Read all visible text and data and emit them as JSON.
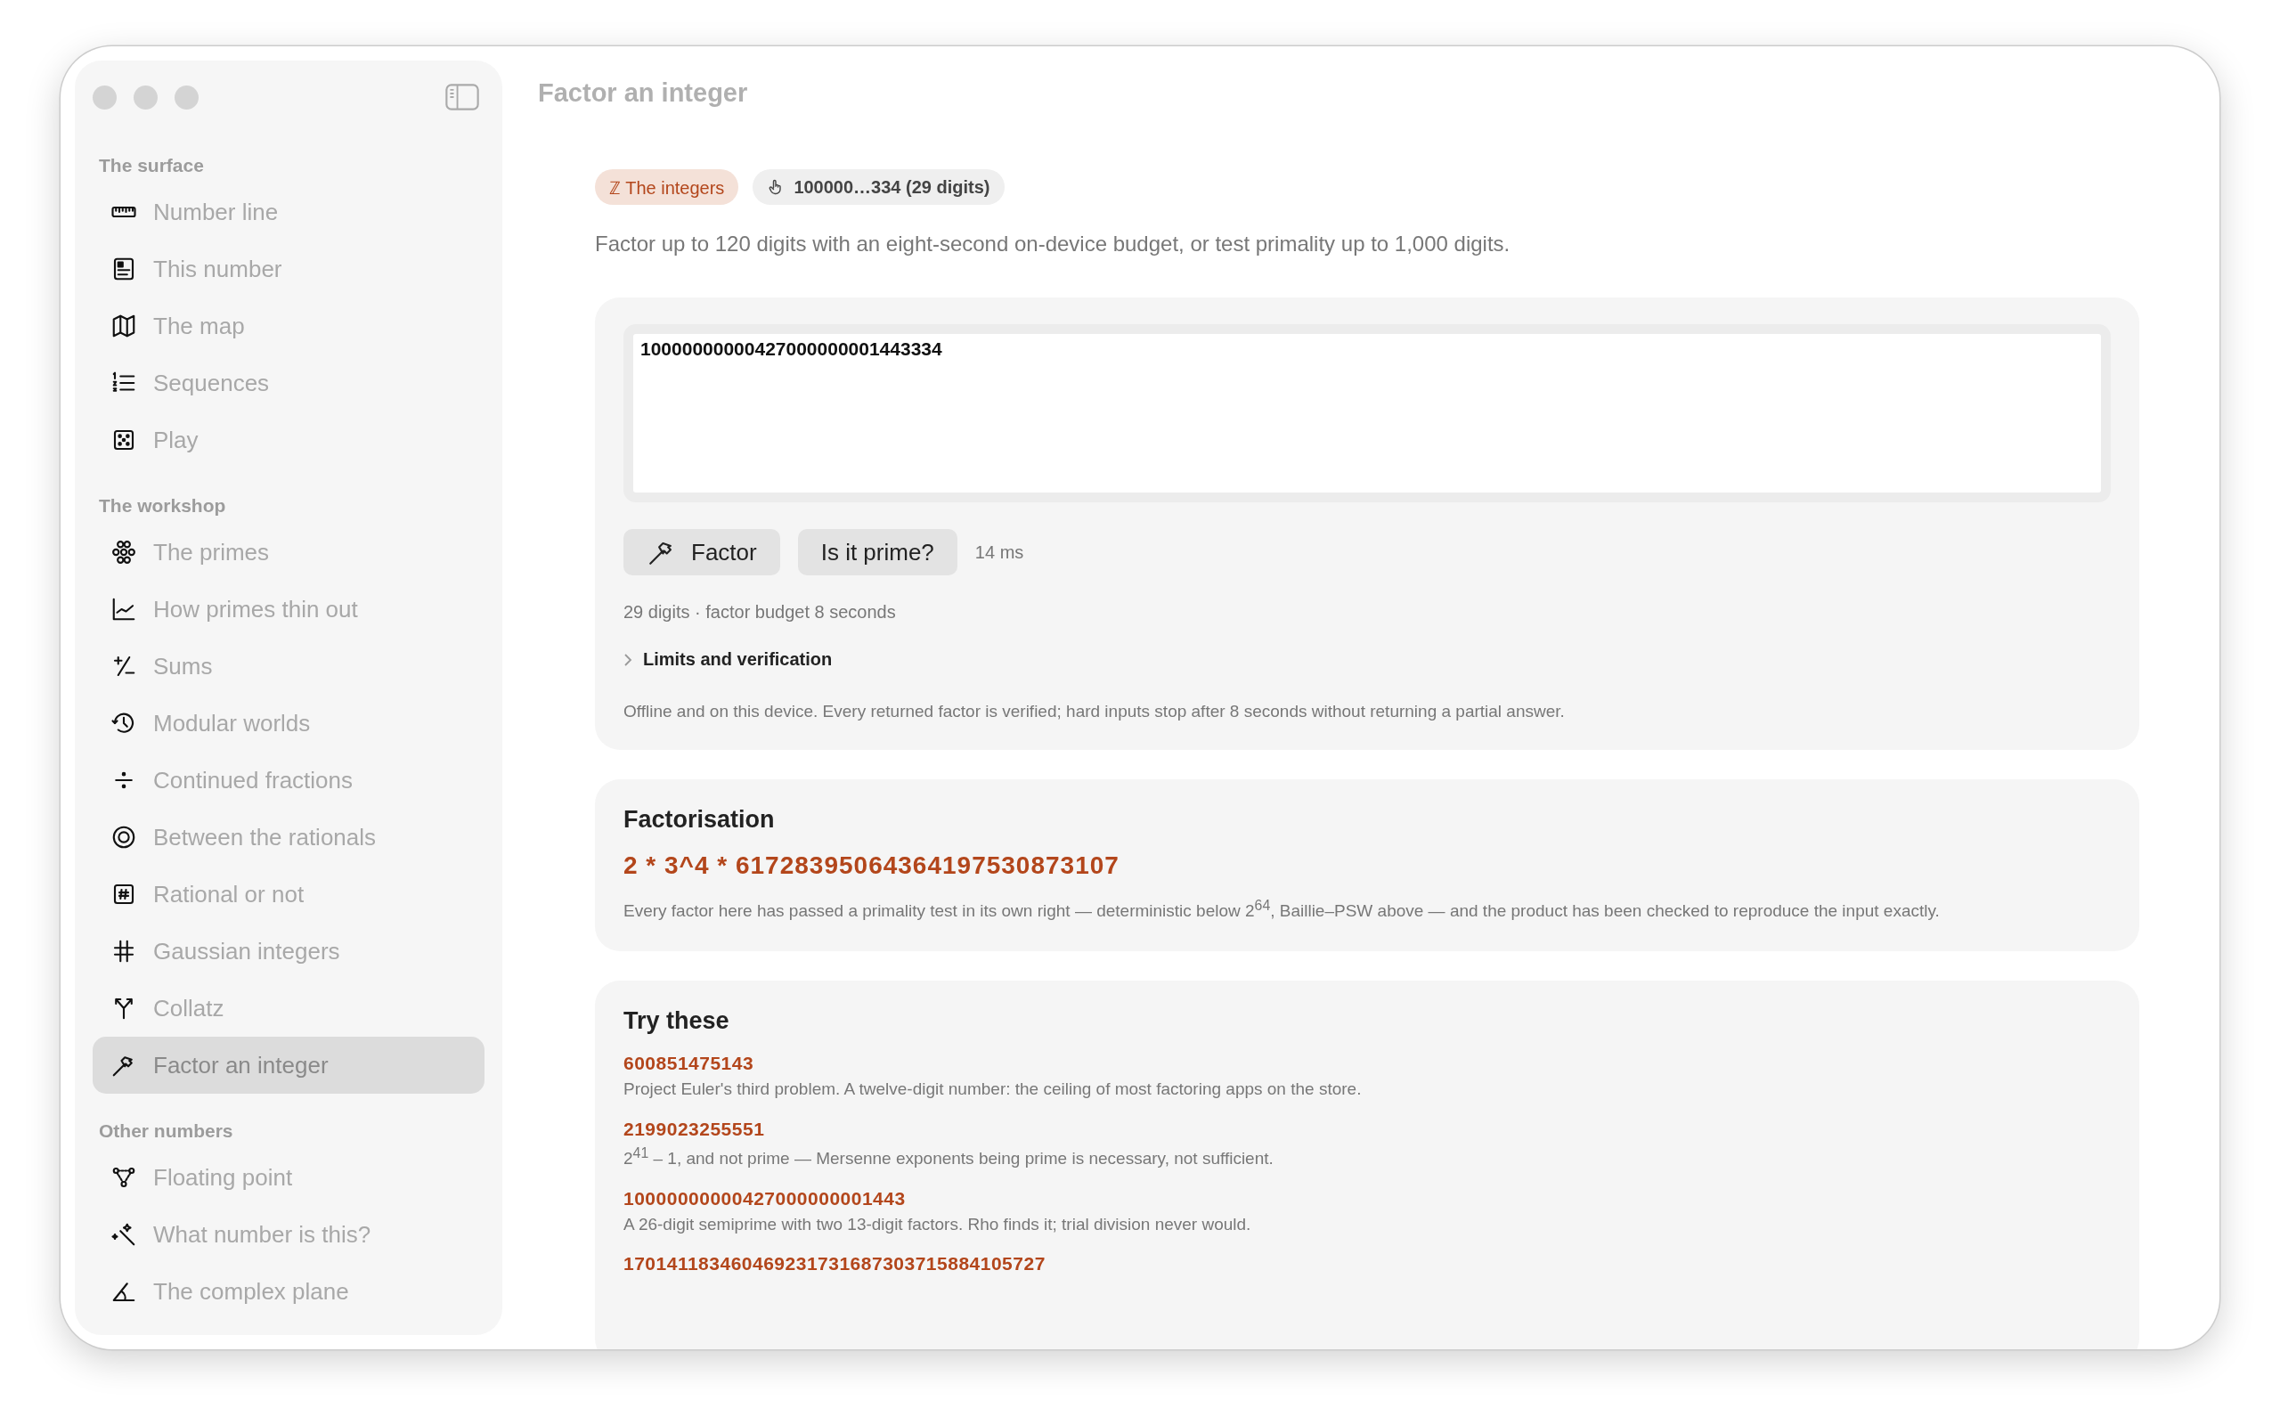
{
  "window": {
    "title": "Factor an integer"
  },
  "sidebar": {
    "sections": [
      {
        "heading": "The surface",
        "items": [
          {
            "label": "Number line",
            "selected": false
          },
          {
            "label": "This number",
            "selected": false
          },
          {
            "label": "The map",
            "selected": false
          },
          {
            "label": "Sequences",
            "selected": false
          },
          {
            "label": "Play",
            "selected": false
          }
        ]
      },
      {
        "heading": "The workshop",
        "items": [
          {
            "label": "The primes",
            "selected": false
          },
          {
            "label": "How primes thin out",
            "selected": false
          },
          {
            "label": "Sums",
            "selected": false
          },
          {
            "label": "Modular worlds",
            "selected": false
          },
          {
            "label": "Continued fractions",
            "selected": false
          },
          {
            "label": "Between the rationals",
            "selected": false
          },
          {
            "label": "Rational or not",
            "selected": false
          },
          {
            "label": "Gaussian integers",
            "selected": false
          },
          {
            "label": "Collatz",
            "selected": false
          },
          {
            "label": "Factor an integer",
            "selected": true
          }
        ]
      },
      {
        "heading": "Other numbers",
        "items": [
          {
            "label": "Floating point",
            "selected": false
          },
          {
            "label": "What number is this?",
            "selected": false
          },
          {
            "label": "The complex plane",
            "selected": false
          }
        ]
      }
    ]
  },
  "badges": [
    {
      "kind": "set",
      "symbol": "ℤ",
      "label": "The integers"
    },
    {
      "kind": "input",
      "label": "100000…334 (29 digits)"
    }
  ],
  "description": "Factor up to 120 digits with an eight-second on-device budget, or test primality up to 1,000 digits.",
  "input": {
    "value": "10000000000427000000001443334"
  },
  "buttons": [
    {
      "kind": "factor",
      "label": "Factor"
    },
    {
      "kind": "plain",
      "label": "Is it prime?"
    }
  ],
  "timing": "14 ms",
  "budget_note": "29 digits · factor budget 8 seconds",
  "disclosure": {
    "label": "Limits and verification",
    "expanded": false
  },
  "note": "Offline and on this device. Every returned factor is verified; hard inputs stop after 8 seconds without returning a partial answer.",
  "factorisation": {
    "heading": "Factorisation",
    "result": "2 * 3^4 * 61728395064364197530873107",
    "note": "Every factor here has passed a primality test in its own right — deterministic below 2$^{64}$, Baillie–PSW above — and the product has been checked to reproduce the input exactly."
  },
  "try_these": {
    "heading": "Try these",
    "examples": [
      {
        "number": "600851475143",
        "description": "Project Euler's third problem. A twelve-digit number: the ceiling of most factoring apps on the store."
      },
      {
        "number": "2199023255551",
        "description": "2$^{41}$ – 1, and not prime — Mersenne exponents being prime is necessary, not sufficient."
      },
      {
        "number": "10000000000427000000001443",
        "description": "A 26-digit semiprime with two 13-digit factors. Rho finds it; trial division never would."
      },
      {
        "number": "170141183460469231731687303715884105727"
      }
    ]
  }
}
